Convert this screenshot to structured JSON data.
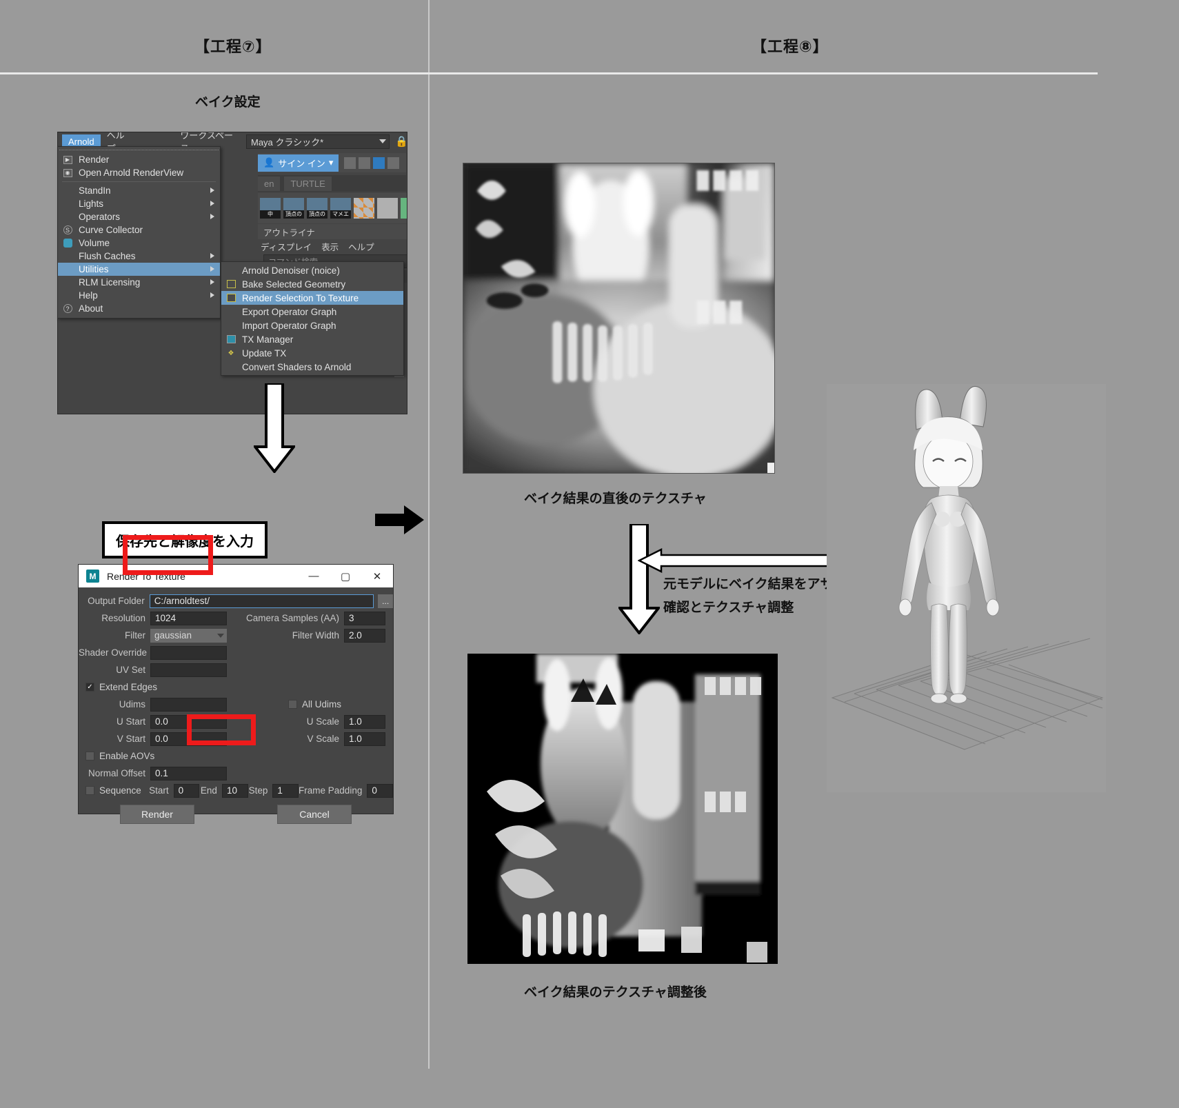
{
  "stages": {
    "left_title": "【工程⑦】",
    "right_title": "【工程⑧】",
    "left_section_label": "ベイク設定"
  },
  "maya": {
    "menubar": {
      "arnold": "Arnold",
      "help": "ヘルプ",
      "workspace_label": "ワークスペース:",
      "workspace_value": "Maya クラシック*",
      "lock_icon": "lock-icon"
    },
    "signin": "サイン イン",
    "tabs": [
      "en",
      "TURTLE"
    ],
    "shelf_caps": [
      "中",
      "頂点の",
      "頂点の",
      "マメエ"
    ],
    "outliner_tab": "アウトライナ",
    "outliner_menu": [
      "ディスプレイ",
      "表示",
      "ヘルプ"
    ],
    "command_search_placeholder": "コマンド検索...",
    "arnold_menu": [
      {
        "label": "Render",
        "icon": "play-box-icon",
        "submenu": false
      },
      {
        "label": "Open Arnold RenderView",
        "icon": "eye-box-icon",
        "submenu": false
      },
      {
        "label": "StandIn",
        "icon": "",
        "submenu": true
      },
      {
        "label": "Lights",
        "icon": "",
        "submenu": true
      },
      {
        "label": "Operators",
        "icon": "",
        "submenu": true
      },
      {
        "label": "Curve Collector",
        "icon": "curve-icon",
        "submenu": false
      },
      {
        "label": "Volume",
        "icon": "volume-icon",
        "submenu": false
      },
      {
        "label": "Flush Caches",
        "icon": "",
        "submenu": true
      },
      {
        "label": "Utilities",
        "icon": "",
        "submenu": true,
        "selected": true
      },
      {
        "label": "RLM Licensing",
        "icon": "",
        "submenu": true
      },
      {
        "label": "Help",
        "icon": "",
        "submenu": true
      },
      {
        "label": "About",
        "icon": "question-icon",
        "submenu": false
      }
    ],
    "arnold_submenu": [
      {
        "label": "Arnold Denoiser (noice)",
        "icon": ""
      },
      {
        "label": "Bake Selected Geometry",
        "icon": "bake-icon"
      },
      {
        "label": "Render Selection To Texture",
        "icon": "render-texture-icon",
        "selected": true
      },
      {
        "label": "Export Operator Graph",
        "icon": ""
      },
      {
        "label": "Import Operator Graph",
        "icon": ""
      },
      {
        "label": "TX Manager",
        "icon": "tx-icon"
      },
      {
        "label": "Update TX",
        "icon": "update-tx-icon"
      },
      {
        "label": "Convert Shaders to Arnold",
        "icon": ""
      }
    ]
  },
  "callout": {
    "save_and_resolution": "保存先と解像度を入力"
  },
  "rtt_dialog": {
    "title": "Render To Texture",
    "app_icon": "M",
    "window_buttons": {
      "minimize": "—",
      "maximize": "▢",
      "close": "✕"
    },
    "fields": {
      "output_folder_label": "Output Folder",
      "output_folder_value": "C:/arnoldtest/",
      "browse_button": "...",
      "resolution_label": "Resolution",
      "resolution_value": "1024",
      "camera_samples_label": "Camera Samples (AA)",
      "camera_samples_value": "3",
      "filter_label": "Filter",
      "filter_value": "gaussian",
      "filter_width_label": "Filter Width",
      "filter_width_value": "2.0",
      "shader_override_label": "Shader Override",
      "shader_override_value": "",
      "uv_set_label": "UV Set",
      "uv_set_value": "",
      "extend_edges_label": "Extend Edges",
      "extend_edges_checked": true,
      "udims_label": "Udims",
      "udims_value": "",
      "all_udims_label": "All Udims",
      "all_udims_checked": false,
      "u_start_label": "U Start",
      "u_start_value": "0.0",
      "u_scale_label": "U Scale",
      "u_scale_value": "1.0",
      "v_start_label": "V Start",
      "v_start_value": "0.0",
      "v_scale_label": "V Scale",
      "v_scale_value": "1.0",
      "enable_aovs_label": "Enable AOVs",
      "enable_aovs_checked": false,
      "normal_offset_label": "Normal Offset",
      "normal_offset_value": "0.1",
      "sequence_label": "Sequence",
      "sequence_checked": false,
      "seq_start_label": "Start",
      "seq_start_value": "0",
      "seq_end_label": "End",
      "seq_end_value": "10",
      "seq_step_label": "Step",
      "seq_step_value": "1",
      "frame_padding_label": "Frame Padding",
      "frame_padding_value": "0"
    },
    "buttons": {
      "render": "Render",
      "cancel": "Cancel"
    }
  },
  "stage8": {
    "caption_before": "ベイク結果の直後のテクスチャ",
    "caption_after": "ベイク結果のテクスチャ調整後",
    "flow_line1": "元モデルにベイク結果をアサインし",
    "flow_line2": "確認とテクスチャ調整"
  },
  "colors": {
    "background": "#9a9a9a",
    "accent_blue": "#5b9bd5",
    "highlight_red": "#ee1b1b",
    "maya_panel": "#454545"
  }
}
